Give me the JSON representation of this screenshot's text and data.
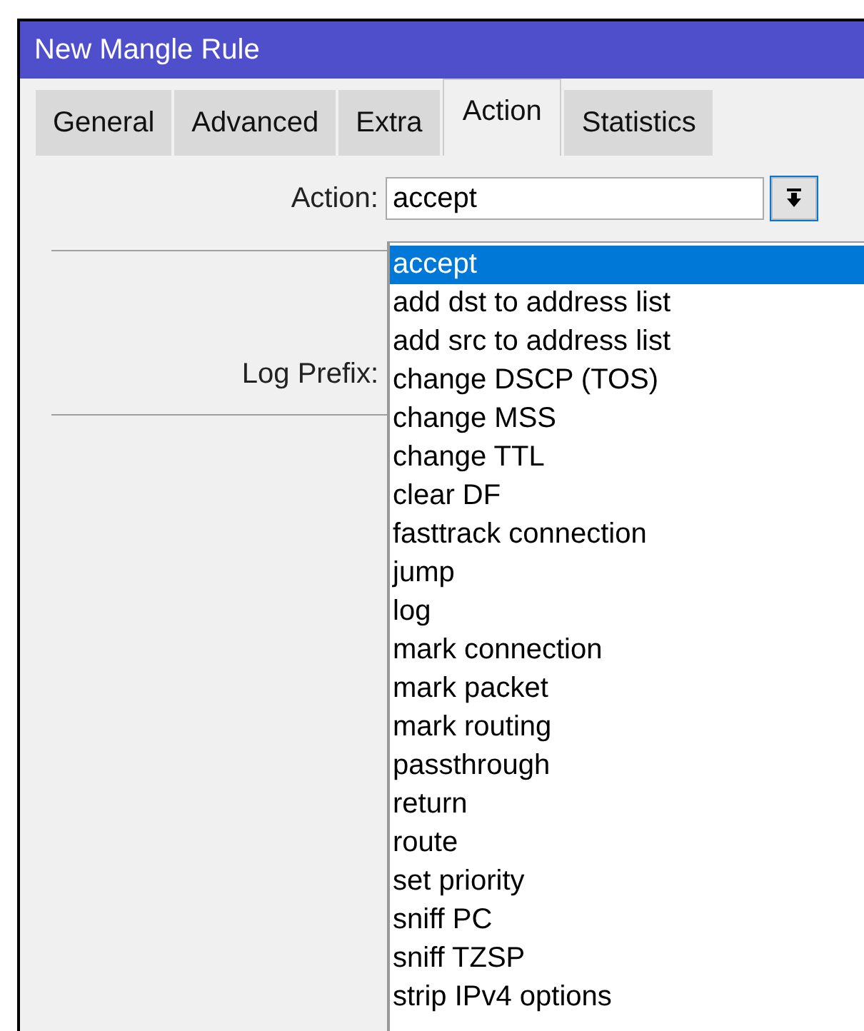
{
  "window": {
    "title": "New Mangle Rule"
  },
  "tabs": [
    {
      "label": "General",
      "selected": false
    },
    {
      "label": "Advanced",
      "selected": false
    },
    {
      "label": "Extra",
      "selected": false
    },
    {
      "label": "Action",
      "selected": true
    },
    {
      "label": "Statistics",
      "selected": false
    }
  ],
  "action_field": {
    "label": "Action:",
    "value": "accept",
    "expanded": true
  },
  "log_prefix": {
    "label": "Log Prefix:"
  },
  "dropdown_options": [
    {
      "label": "accept",
      "selected": true
    },
    {
      "label": "add dst to address list",
      "selected": false
    },
    {
      "label": "add src to address list",
      "selected": false
    },
    {
      "label": "change DSCP (TOS)",
      "selected": false
    },
    {
      "label": "change MSS",
      "selected": false
    },
    {
      "label": "change TTL",
      "selected": false
    },
    {
      "label": "clear DF",
      "selected": false
    },
    {
      "label": "fasttrack connection",
      "selected": false
    },
    {
      "label": "jump",
      "selected": false
    },
    {
      "label": "log",
      "selected": false
    },
    {
      "label": "mark connection",
      "selected": false
    },
    {
      "label": "mark packet",
      "selected": false
    },
    {
      "label": "mark routing",
      "selected": false
    },
    {
      "label": "passthrough",
      "selected": false
    },
    {
      "label": "return",
      "selected": false
    },
    {
      "label": "route",
      "selected": false
    },
    {
      "label": "set priority",
      "selected": false
    },
    {
      "label": "sniff PC",
      "selected": false
    },
    {
      "label": "sniff TZSP",
      "selected": false
    },
    {
      "label": "strip IPv4 options",
      "selected": false
    }
  ]
}
